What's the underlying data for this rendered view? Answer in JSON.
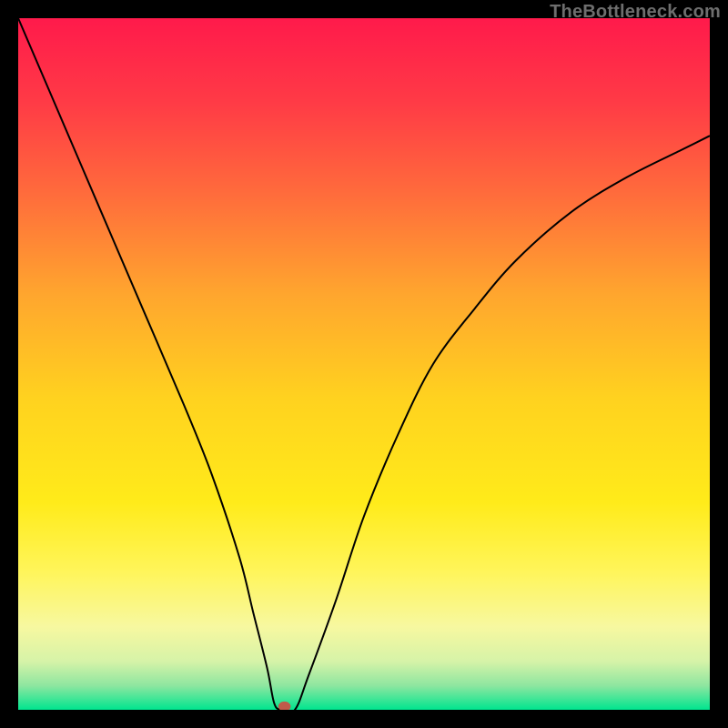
{
  "watermark": "TheBottleneck.com",
  "chart_data": {
    "type": "line",
    "title": "",
    "xlabel": "",
    "ylabel": "",
    "xlim": [
      0,
      100
    ],
    "ylim": [
      0,
      100
    ],
    "background_gradient": {
      "direction": "vertical",
      "stops": [
        {
          "pos": 0.0,
          "color": "#ff1a4b"
        },
        {
          "pos": 0.12,
          "color": "#ff3a46"
        },
        {
          "pos": 0.25,
          "color": "#ff6a3c"
        },
        {
          "pos": 0.4,
          "color": "#ffa62e"
        },
        {
          "pos": 0.55,
          "color": "#ffd21f"
        },
        {
          "pos": 0.7,
          "color": "#ffeb1a"
        },
        {
          "pos": 0.8,
          "color": "#fff55a"
        },
        {
          "pos": 0.88,
          "color": "#f7f8a0"
        },
        {
          "pos": 0.93,
          "color": "#d6f3a8"
        },
        {
          "pos": 0.965,
          "color": "#8ee6a0"
        },
        {
          "pos": 1.0,
          "color": "#00e58f"
        }
      ]
    },
    "series": [
      {
        "name": "bottleneck-curve",
        "color": "#000000",
        "x": [
          0,
          6,
          12,
          18,
          24,
          28,
          32,
          34,
          36,
          37,
          38,
          40,
          42,
          46,
          50,
          55,
          60,
          66,
          72,
          80,
          88,
          96,
          100
        ],
        "y": [
          100,
          86,
          72,
          58,
          44,
          34,
          22,
          14,
          6,
          1,
          0,
          0,
          5,
          16,
          28,
          40,
          50,
          58,
          65,
          72,
          77,
          81,
          83
        ]
      }
    ],
    "marker": {
      "x": 38.5,
      "y": 0.5,
      "color": "#c05a4a",
      "radius": 1.0
    }
  }
}
